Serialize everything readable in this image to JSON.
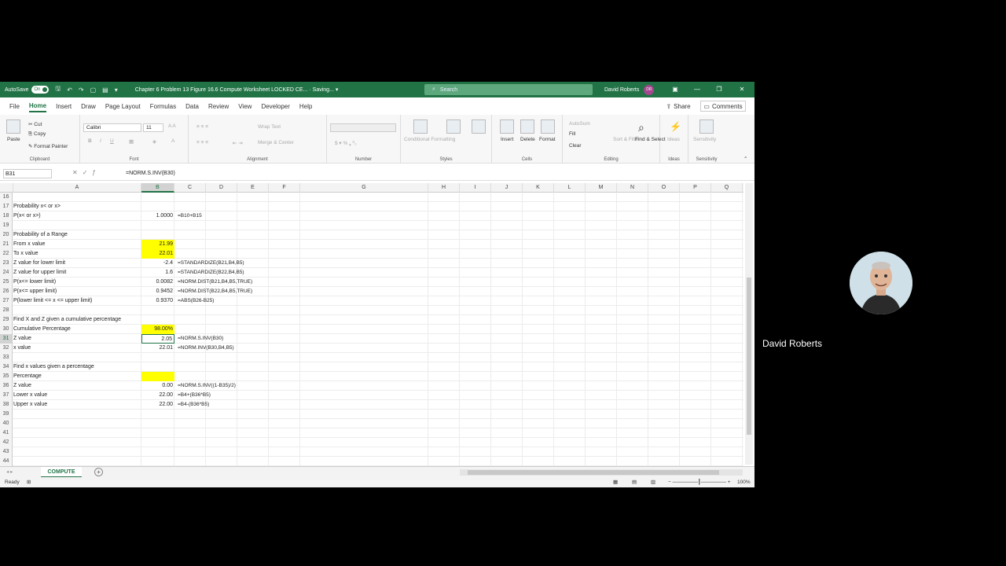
{
  "titlebar": {
    "autosave_label": "AutoSave",
    "autosave_state": "On",
    "doc_title": "Chapter 6 Problem 13 Figure 16.6 Compute Worksheet LOCKED CE...  ·  Saving...  ▾",
    "search_placeholder": "Search",
    "user_name": "David Roberts",
    "user_initials": "DR"
  },
  "menu": {
    "items": [
      "File",
      "Home",
      "Insert",
      "Draw",
      "Page Layout",
      "Formulas",
      "Data",
      "Review",
      "View",
      "Developer",
      "Help"
    ],
    "share": "Share",
    "comments": "Comments"
  },
  "ribbon": {
    "clipboard": {
      "label": "Clipboard",
      "paste": "Paste",
      "cut": "Cut",
      "copy": "Copy",
      "format_painter": "Format Painter"
    },
    "font": {
      "label": "Font",
      "name": "Calibri",
      "size": "11"
    },
    "alignment": {
      "label": "Alignment",
      "wrap": "Wrap Text",
      "merge": "Merge & Center"
    },
    "number": {
      "label": "Number"
    },
    "styles": {
      "label": "Styles",
      "conditional": "Conditional Formatting",
      "format_table": "Format as Table",
      "cell_styles": "Cell Styles"
    },
    "cells": {
      "label": "Cells",
      "insert": "Insert",
      "delete": "Delete",
      "format": "Format"
    },
    "editing": {
      "label": "Editing",
      "autosum": "AutoSum",
      "fill": "Fill",
      "clear": "Clear",
      "sort": "Sort & Filter",
      "find": "Find & Select"
    },
    "ideas": {
      "label": "Ideas",
      "btn": "Ideas"
    },
    "sensitivity": {
      "label": "Sensitivity",
      "btn": "Sensitivity"
    }
  },
  "formula_bar": {
    "name_box": "B31",
    "formula": "=NORM.S.INV(B30)"
  },
  "columns": [
    "A",
    "B",
    "C",
    "D",
    "E",
    "F",
    "G",
    "H",
    "I",
    "J",
    "K",
    "L",
    "M",
    "N",
    "O",
    "P",
    "Q"
  ],
  "rows": [
    {
      "n": "16",
      "a": "",
      "b": "",
      "c": ""
    },
    {
      "n": "17",
      "a": "Probability x< or x>",
      "b": "",
      "c": ""
    },
    {
      "n": "18",
      "a": "P(x< or x>)",
      "b": "1.0000",
      "c": "=B10+B15"
    },
    {
      "n": "19",
      "a": "",
      "b": "",
      "c": ""
    },
    {
      "n": "20",
      "a": "Probability of a Range",
      "b": "",
      "c": ""
    },
    {
      "n": "21",
      "a": "From x value",
      "b": "21.99",
      "c": ""
    },
    {
      "n": "22",
      "a": "To x value",
      "b": "22.01",
      "c": ""
    },
    {
      "n": "23",
      "a": "Z value for lower limit",
      "b": "-2.4",
      "c": "=STANDARDIZE(B21,B4,B5)"
    },
    {
      "n": "24",
      "a": "Z value for upper limit",
      "b": "1.6",
      "c": "=STANDARDIZE(B22,B4,B5)"
    },
    {
      "n": "25",
      "a": "P(x<= lower limit)",
      "b": "0.0082",
      "c": "=NORM.DIST(B21,B4,B5,TRUE)"
    },
    {
      "n": "26",
      "a": "P(x<= upper limit)",
      "b": "0.9452",
      "c": "=NORM.DIST(B22,B4,B5,TRUE)"
    },
    {
      "n": "27",
      "a": "P(lower limit <= x <= upper limit)",
      "b": "0.9370",
      "c": "=ABS(B26-B25)"
    },
    {
      "n": "28",
      "a": "",
      "b": "",
      "c": ""
    },
    {
      "n": "29",
      "a": "Find X and Z given a cumulative percentage",
      "b": "",
      "c": ""
    },
    {
      "n": "30",
      "a": "Cumulative Percentage",
      "b": "98.00%",
      "c": ""
    },
    {
      "n": "31",
      "a": "Z value",
      "b": "2.05",
      "c": "=NORM.S.INV(B30)"
    },
    {
      "n": "32",
      "a": "x value",
      "b": "22.01",
      "c": "=NORM.INV(B30,B4,B5)"
    },
    {
      "n": "33",
      "a": "",
      "b": "",
      "c": ""
    },
    {
      "n": "34",
      "a": "Find x values given a percentage",
      "b": "",
      "c": ""
    },
    {
      "n": "35",
      "a": "Percentage",
      "b": "",
      "c": ""
    },
    {
      "n": "36",
      "a": "Z value",
      "b": "0.00",
      "c": "=NORM.S.INV((1-B35)/2)"
    },
    {
      "n": "37",
      "a": "Lower x value",
      "b": "22.00",
      "c": "=B4+(B36*B5)"
    },
    {
      "n": "38",
      "a": "Upper x value",
      "b": "22.00",
      "c": "=B4-(B36*B5)"
    },
    {
      "n": "39",
      "a": "",
      "b": "",
      "c": ""
    },
    {
      "n": "40",
      "a": "",
      "b": "",
      "c": ""
    },
    {
      "n": "41",
      "a": "",
      "b": "",
      "c": ""
    },
    {
      "n": "42",
      "a": "",
      "b": "",
      "c": ""
    },
    {
      "n": "43",
      "a": "",
      "b": "",
      "c": ""
    },
    {
      "n": "44",
      "a": "",
      "b": "",
      "c": ""
    }
  ],
  "sheet_tab": "COMPUTE",
  "status": {
    "ready": "Ready",
    "zoom": "100%"
  },
  "participant": {
    "name": "David Roberts"
  },
  "colors": {
    "excel_green": "#217346",
    "input_yellow": "#ffff00"
  }
}
